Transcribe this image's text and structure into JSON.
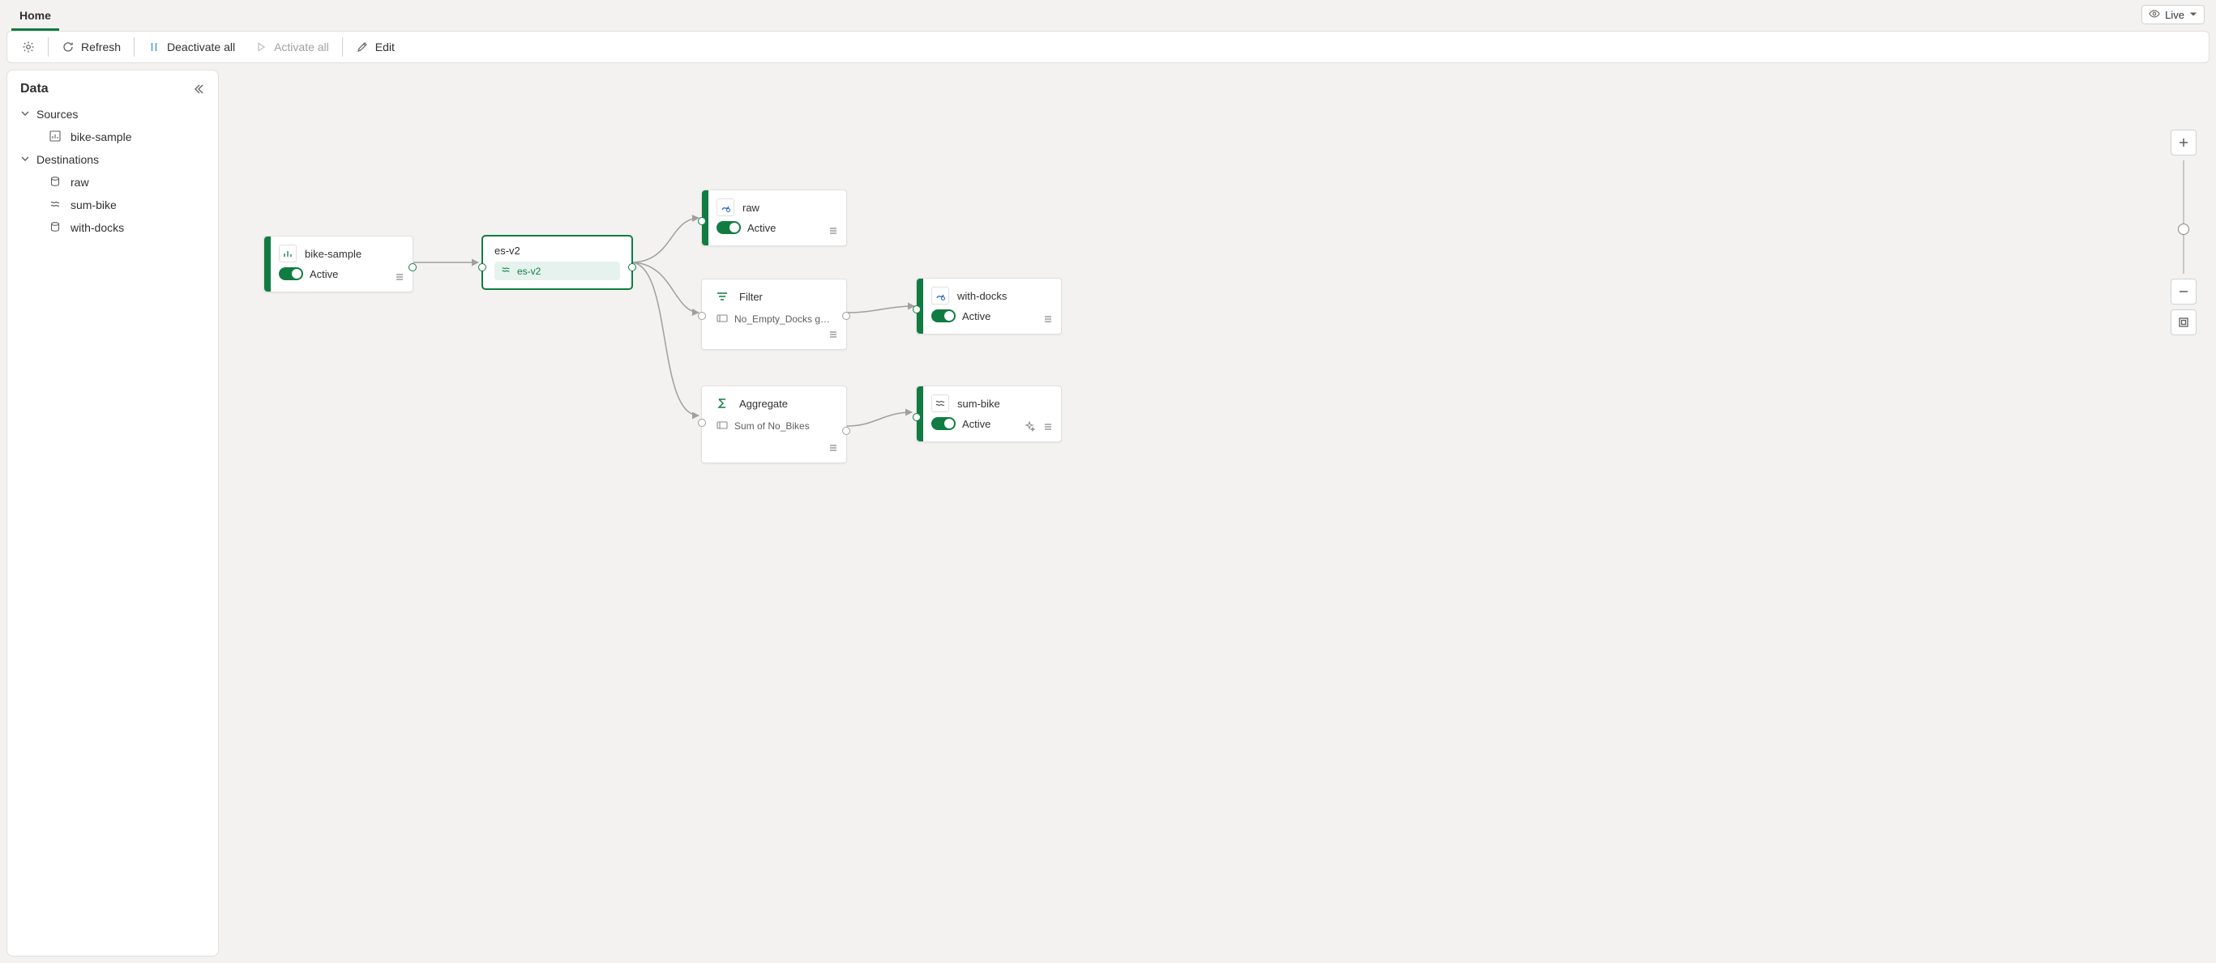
{
  "tabs": {
    "home": "Home"
  },
  "live": {
    "label": "Live"
  },
  "toolbar": {
    "refresh": "Refresh",
    "deactivate_all": "Deactivate all",
    "activate_all": "Activate all",
    "edit": "Edit"
  },
  "sidepanel": {
    "title": "Data",
    "groups": {
      "sources": "Sources",
      "destinations": "Destinations"
    },
    "sources": [
      {
        "label": "bike-sample"
      }
    ],
    "destinations": [
      {
        "label": "raw"
      },
      {
        "label": "sum-bike"
      },
      {
        "label": "with-docks"
      }
    ]
  },
  "nodes": {
    "bike_sample": {
      "title": "bike-sample",
      "status": "Active"
    },
    "es_v2": {
      "title": "es-v2",
      "pill": "es-v2"
    },
    "raw": {
      "title": "raw",
      "status": "Active"
    },
    "filter": {
      "title": "Filter",
      "rule": "No_Empty_Docks greater t..."
    },
    "aggregate": {
      "title": "Aggregate",
      "rule": "Sum of No_Bikes"
    },
    "with_docks": {
      "title": "with-docks",
      "status": "Active"
    },
    "sum_bike": {
      "title": "sum-bike",
      "status": "Active"
    }
  }
}
